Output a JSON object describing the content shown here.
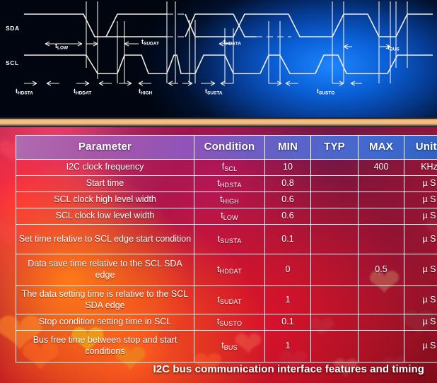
{
  "diagram": {
    "signal_labels": [
      "SDA",
      "SCL"
    ],
    "timing_marks": [
      {
        "name": "t",
        "sub": "LOW"
      },
      {
        "name": "t",
        "sub": "SUDAT"
      },
      {
        "name": "t",
        "sub": "HDSTA"
      },
      {
        "name": "t",
        "sub": "BUS"
      },
      {
        "name": "t",
        "sub": "HDSTA"
      },
      {
        "name": "t",
        "sub": "HDDAT"
      },
      {
        "name": "t",
        "sub": "HIGH"
      },
      {
        "name": "t",
        "sub": "SUSTA"
      },
      {
        "name": "t",
        "sub": "SUSTO"
      }
    ]
  },
  "table": {
    "headers": [
      "Parameter",
      "Condition",
      "MIN",
      "TYP",
      "MAX",
      "Units"
    ],
    "rows": [
      {
        "parameter": "I2C clock frequency",
        "condition_main": "f",
        "condition_sub": "SCL",
        "min": "10",
        "typ": "",
        "max": "400",
        "units": "KHz"
      },
      {
        "parameter": "Start time",
        "condition_main": "t",
        "condition_sub": "HDSTA",
        "min": "0.8",
        "typ": "",
        "max": "",
        "units": "µ S"
      },
      {
        "parameter": "SCL clock high level width",
        "condition_main": "t",
        "condition_sub": "HIGH",
        "min": "0.6",
        "typ": "",
        "max": "",
        "units": "µ S"
      },
      {
        "parameter": "SCL clock low level width",
        "condition_main": "t",
        "condition_sub": "LOW",
        "min": "0.6",
        "typ": "",
        "max": "",
        "units": "µ S"
      },
      {
        "parameter": "Set time relative to SCL edge start condition",
        "condition_main": "t",
        "condition_sub": "SUSTA",
        "min": "0.1",
        "typ": "",
        "max": "",
        "units": "µ S"
      },
      {
        "parameter": "Data save time relative to the SCL SDA edge",
        "condition_main": "t",
        "condition_sub": "HDDAT",
        "min": "0",
        "typ": "",
        "max": "0.5",
        "units": "µ S"
      },
      {
        "parameter": "The data setting time is relative to the SCL SDA edge",
        "condition_main": "t",
        "condition_sub": "SUDAT",
        "min": "1",
        "typ": "",
        "max": "",
        "units": "µ S"
      },
      {
        "parameter": "Stop condition setting time in SCL",
        "condition_main": "t",
        "condition_sub": "SUSTO",
        "min": "0.1",
        "typ": "",
        "max": "",
        "units": "µ S"
      },
      {
        "parameter": "Bus free time between stop and start conditions",
        "condition_main": "t",
        "condition_sub": "BUS",
        "min": "1",
        "typ": "",
        "max": "",
        "units": "µ S"
      }
    ]
  },
  "caption": "I2C bus communication interface features and timing",
  "colors": {
    "table_border": "#ffffff",
    "text": "#ffffff",
    "divider_band": "#f0b678",
    "diagram_bg_accent": "#1e86ff",
    "waveform": "#f2ece2"
  }
}
